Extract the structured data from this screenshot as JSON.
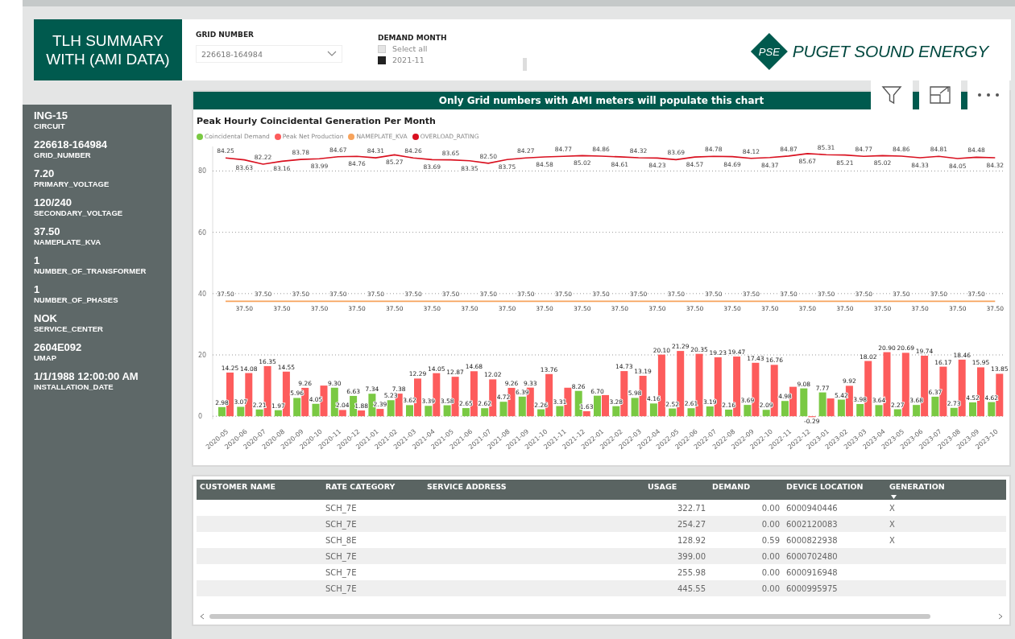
{
  "title": "TLH SUMMARY WITH (AMI DATA)",
  "filters": {
    "grid_number": {
      "label": "GRID NUMBER",
      "value": "226618-164984"
    },
    "demand_month": {
      "label": "DEMAND MONTH",
      "items": [
        {
          "label": "Select all",
          "checked": false
        },
        {
          "label": "2021-11",
          "checked": true
        }
      ]
    }
  },
  "logo": {
    "mark": "PSE",
    "name": "PUGET SOUND ENERGY"
  },
  "details": [
    {
      "value": "ING-15",
      "label": "CIRCUIT"
    },
    {
      "value": "226618-164984",
      "label": "GRID_NUMBER"
    },
    {
      "value": "7.20",
      "label": "PRIMARY_VOLTAGE"
    },
    {
      "value": "120/240",
      "label": "SECONDARY_VOLTAGE"
    },
    {
      "value": "37.50",
      "label": "NAMEPLATE_KVA"
    },
    {
      "value": "1",
      "label": "NUMBER_OF_TRANSFORMER"
    },
    {
      "value": "1",
      "label": "NUMBER_OF_PHASES"
    },
    {
      "value": "NOK",
      "label": "SERVICE_CENTER"
    },
    {
      "value": "2604E092",
      "label": "UMAP"
    },
    {
      "value": "1/1/1988 12:00:00 AM",
      "label": "INSTALLATION_DATE"
    }
  ],
  "banner": "Only Grid numbers with AMI meters will populate this chart",
  "chart": {
    "chart_data": {
      "type": "bar",
      "title": "Peak Hourly Coincidental Generation Per Month",
      "grid": true,
      "ylim": [
        -1,
        88
      ],
      "yticks": [
        0,
        20,
        40,
        60,
        80
      ],
      "categories": [
        "2020-05",
        "2020-06",
        "2020-07",
        "2020-08",
        "2020-09",
        "2020-10",
        "2020-11",
        "2020-12",
        "2021-01",
        "2021-02",
        "2021-03",
        "2021-04",
        "2021-05",
        "2021-06",
        "2021-07",
        "2021-08",
        "2021-09",
        "2021-10",
        "2021-11",
        "2021-12",
        "2022-01",
        "2022-02",
        "2022-03",
        "2022-04",
        "2022-05",
        "2022-06",
        "2022-07",
        "2022-08",
        "2022-09",
        "2022-10",
        "2022-11",
        "2022-12",
        "2023-01",
        "2023-02",
        "2023-03",
        "2023-04",
        "2023-05",
        "2023-06",
        "2023-07",
        "2023-08",
        "2023-09",
        "2023-10"
      ],
      "series": [
        {
          "name": "Coincidental Demand",
          "type": "bar",
          "color": "#7ac943",
          "values": [
            2.98,
            3.07,
            2.21,
            1.97,
            5.96,
            4.05,
            9.3,
            6.63,
            7.34,
            5.23,
            3.62,
            3.39,
            3.58,
            2.65,
            2.62,
            4.72,
            6.39,
            2.26,
            3.31,
            8.26,
            6.7,
            3.28,
            5.98,
            4.16,
            2.52,
            2.61,
            3.19,
            2.16,
            3.69,
            2.09,
            4.98,
            9.08,
            7.77,
            5.42,
            3.98,
            3.64,
            2.27,
            3.68,
            6.37,
            2.73,
            4.52,
            4.62
          ],
          "value_labels": [
            "2.98",
            "3.07",
            "2.21",
            "1.97",
            "5.96",
            "4.05",
            "9.30",
            "6.63",
            "7.34",
            "5.23",
            "3.62",
            "3.39",
            "3.58",
            "2.65",
            "2.62",
            "4.72",
            "6.39",
            "2.26",
            "3.31",
            "8.26",
            "6.70",
            "3.28",
            "5.98",
            "4.16",
            "2.52",
            "2.61",
            "3.19",
            "2.16",
            "3.69",
            "2.09",
            "4.98",
            "9.08",
            "7.77",
            "5.42",
            "3.98",
            "3.64",
            "2.27",
            "3.68",
            "6.37",
            "2.73",
            "4.52",
            "4.62"
          ]
        },
        {
          "name": "Peak Net Production",
          "type": "bar",
          "color": "#fd5c5c",
          "values": [
            14.25,
            14.08,
            16.35,
            14.55,
            9.26,
            10,
            2.04,
            1.88,
            2.39,
            7.38,
            12.29,
            14.05,
            12.87,
            14.68,
            12.02,
            9.26,
            9.33,
            13.76,
            9.3,
            1.63,
            6.9,
            14.73,
            13.19,
            20.1,
            21.29,
            20.35,
            19.23,
            19.47,
            17.43,
            16.76,
            9.6,
            -0.29,
            5.8,
            9.92,
            18.02,
            20.9,
            20.69,
            19.74,
            16.17,
            18.46,
            15.95,
            13.85
          ],
          "value_labels": [
            "14.25",
            "14.08",
            "16.35",
            "14.55",
            "9.26",
            null,
            "2.04",
            "1.88",
            "2.39",
            "7.38",
            "12.29",
            "14.05",
            "12.87",
            "14.68",
            "12.02",
            "9.26",
            "9.33",
            "13.76",
            null,
            "1.63",
            null,
            "14.73",
            "13.19",
            "20.10",
            "21.29",
            "20.35",
            "19.23",
            "19.47",
            "17.43",
            "16.76",
            null,
            "-0.29",
            null,
            "9.92",
            "18.02",
            "20.90",
            "20.69",
            "19.74",
            "16.17",
            "18.46",
            "15.95",
            "13.85"
          ]
        },
        {
          "name": "NAMEPLATE_KVA",
          "type": "line",
          "color": "#f7a35c",
          "values": [
            37.5,
            37.5,
            37.5,
            37.5,
            37.5,
            37.5,
            37.5,
            37.5,
            37.5,
            37.5,
            37.5,
            37.5,
            37.5,
            37.5,
            37.5,
            37.5,
            37.5,
            37.5,
            37.5,
            37.5,
            37.5,
            37.5,
            37.5,
            37.5,
            37.5,
            37.5,
            37.5,
            37.5,
            37.5,
            37.5,
            37.5,
            37.5,
            37.5,
            37.5,
            37.5,
            37.5,
            37.5,
            37.5,
            37.5,
            37.5,
            37.5,
            37.5
          ],
          "value_labels": [
            "37.50",
            "37.50",
            "37.50",
            "37.50",
            "37.50",
            "37.50",
            "37.50",
            "37.50",
            "37.50",
            "37.50",
            "37.50",
            "37.50",
            "37.50",
            "37.50",
            "37.50",
            "37.50",
            "37.50",
            "37.50",
            "37.50",
            "37.50",
            "37.50",
            "37.50",
            "37.50",
            "37.50",
            "37.50",
            "37.50",
            "37.50",
            "37.50",
            "37.50",
            "37.50",
            "37.50",
            "37.50",
            "37.50",
            "37.50",
            "37.50",
            "37.50",
            "37.50",
            "37.50",
            "37.50",
            "37.50",
            "37.50",
            "37.50"
          ]
        },
        {
          "name": "OVERLOAD_RATING",
          "type": "line",
          "color": "#d9101f",
          "values": [
            84.25,
            83.63,
            82.22,
            83.16,
            83.78,
            83.99,
            84.67,
            84.76,
            84.31,
            85.27,
            84.26,
            83.69,
            83.65,
            83.35,
            82.5,
            83.75,
            84.27,
            84.58,
            84.77,
            85.02,
            84.86,
            84.61,
            84.32,
            84.23,
            83.69,
            84.57,
            84.78,
            84.69,
            84.12,
            84.37,
            84.87,
            85.67,
            85.31,
            85.21,
            84.77,
            85.02,
            84.86,
            84.33,
            84.81,
            84.05,
            84.48,
            84.32
          ],
          "value_labels": [
            "84.25",
            "83.63",
            "82.22",
            "83.16",
            "83.78",
            "83.99",
            "84.67",
            "84.76",
            "84.31",
            "85.27",
            "84.26",
            "83.69",
            "83.65",
            "83.35",
            "82.50",
            "83.75",
            "84.27",
            "84.58",
            "84.77",
            "85.02",
            "84.86",
            "84.61",
            "84.32",
            "84.23",
            "83.69",
            "84.57",
            "84.78",
            "84.69",
            "84.12",
            "84.37",
            "84.87",
            "85.67",
            "85.31",
            "85.21",
            "84.77",
            "85.02",
            "84.86",
            "84.33",
            "84.81",
            "84.05",
            "84.48",
            "84.32"
          ]
        }
      ]
    }
  },
  "table": {
    "columns": [
      "CUSTOMER NAME",
      "RATE CATEGORY",
      "SERVICE ADDRESS",
      "USAGE",
      "DEMAND",
      "DEVICE LOCATION",
      "GENERATION"
    ],
    "rows": [
      {
        "rate_category": "SCH_7E",
        "usage": "322.71",
        "demand": "0.00",
        "device_location": "6000940446",
        "generation": "X"
      },
      {
        "rate_category": "SCH_7E",
        "usage": "254.27",
        "demand": "0.00",
        "device_location": "6002120083",
        "generation": "X"
      },
      {
        "rate_category": "SCH_8E",
        "usage": "128.92",
        "demand": "0.59",
        "device_location": "6000822938",
        "generation": "X"
      },
      {
        "rate_category": "SCH_7E",
        "usage": "399.00",
        "demand": "0.00",
        "device_location": "6000702480"
      },
      {
        "rate_category": "SCH_7E",
        "usage": "255.98",
        "demand": "0.00",
        "device_location": "6000916948"
      },
      {
        "rate_category": "SCH_7E",
        "usage": "445.55",
        "demand": "0.00",
        "device_location": "6000995975"
      }
    ]
  }
}
